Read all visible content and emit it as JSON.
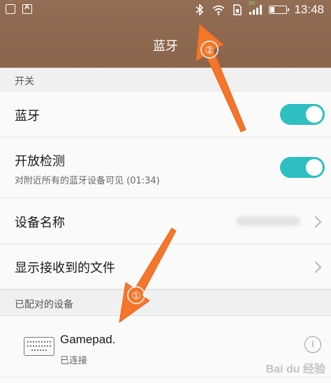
{
  "status_bar": {
    "time": "13:48",
    "icons": [
      "image-icon",
      "a-icon",
      "bluetooth-icon",
      "wifi-icon",
      "sim-icon",
      "signal-icon",
      "battery-icon"
    ],
    "battery_level_fraction": 0.25,
    "signal_tag": "3G"
  },
  "header": {
    "title": "蓝牙"
  },
  "sections": {
    "switch": "开关",
    "paired": "已配对的设备"
  },
  "settings": {
    "bluetooth": {
      "label": "蓝牙",
      "enabled": true
    },
    "discoverable": {
      "label": "开放检测",
      "sub": "对附近所有的蓝牙设备可见 (01:34)",
      "enabled": true
    },
    "device_name": {
      "label": "设备名称"
    },
    "received_files": {
      "label": "显示接收到的文件"
    }
  },
  "paired_device": {
    "name": "Gamepad.",
    "status": "已连接",
    "icon": "keyboard-icon"
  },
  "annotations": {
    "marker1": "①",
    "marker2": "②",
    "arrow_color": "#f5762a"
  },
  "colors": {
    "header_brown": "#8f6a51",
    "toggle_teal": "#2ebfc0"
  },
  "watermark": "Bai du 经验"
}
